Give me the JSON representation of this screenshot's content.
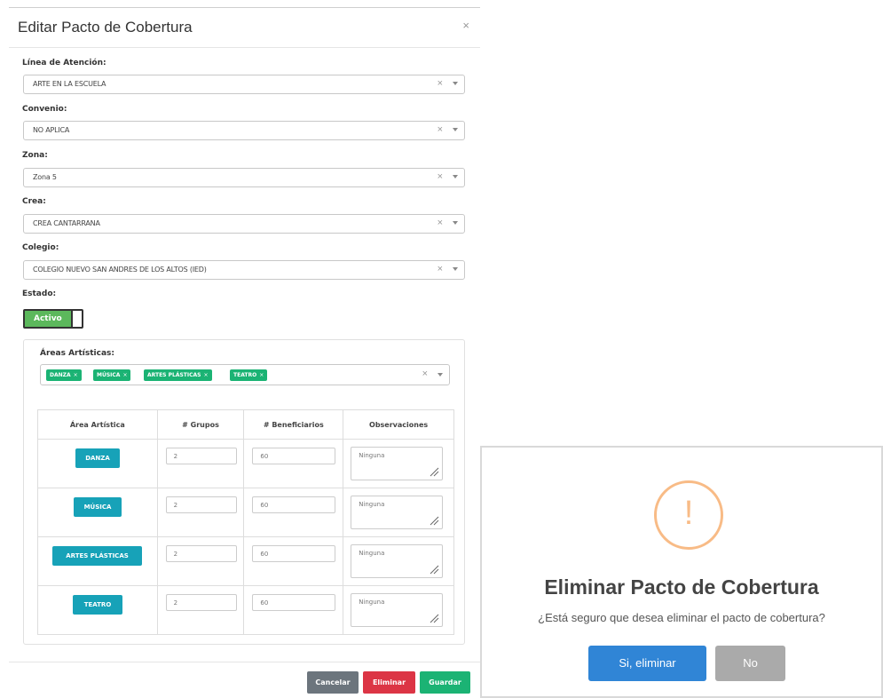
{
  "edit_modal": {
    "title": "Editar Pacto de Cobertura",
    "close_glyph": "×",
    "fields": [
      {
        "label": "Línea de Atención:",
        "value": "ARTE EN LA ESCUELA"
      },
      {
        "label": "Convenio:",
        "value": "NO APLICA"
      },
      {
        "label": "Zona:",
        "value": "Zona 5"
      },
      {
        "label": "Crea:",
        "value": "CREA CANTARRANA"
      },
      {
        "label": "Colegio:",
        "value": "COLEGIO NUEVO SAN ANDRES DE LOS ALTOS (IED)"
      }
    ],
    "clear_glyph": "×",
    "estado": {
      "label": "Estado:",
      "toggle_text": "Activo"
    },
    "areas": {
      "label": "Áreas Artísticas:",
      "chips": [
        "DANZA",
        "MÚSICA",
        "ARTES PLÁSTICAS",
        "TEATRO"
      ],
      "chip_remove_glyph": "×",
      "headers": [
        "Área Artística",
        "# Grupos",
        "# Beneficiarios",
        "Observaciones"
      ],
      "rows": [
        {
          "area": "DANZA",
          "grupos": "2",
          "beneficiarios": "60",
          "observaciones": "Ninguna"
        },
        {
          "area": "MÚSICA",
          "grupos": "2",
          "beneficiarios": "60",
          "observaciones": "Ninguna"
        },
        {
          "area": "ARTES PLÁSTICAS",
          "grupos": "2",
          "beneficiarios": "60",
          "observaciones": "Ninguna"
        },
        {
          "area": "TEATRO",
          "grupos": "2",
          "beneficiarios": "60",
          "observaciones": "Ninguna"
        }
      ]
    },
    "footer": {
      "cancel": "Cancelar",
      "delete": "Eliminar",
      "save": "Guardar"
    }
  },
  "confirm_dialog": {
    "icon_glyph": "!",
    "title": "Eliminar Pacto de Cobertura",
    "message": "¿Está seguro que desea eliminar el pacto de cobertura?",
    "confirm": "Si, eliminar",
    "cancel": "No"
  },
  "colors": {
    "toggle_active": "#5cb85c",
    "chip": "#1bb374",
    "area_button": "#17a2b8",
    "cancel_button": "#6c757d",
    "delete_button": "#dc3545",
    "save_button": "#1bb374",
    "warning": "#f8bb86",
    "confirm_button": "#3085d6",
    "no_button": "#aaaaaa"
  }
}
